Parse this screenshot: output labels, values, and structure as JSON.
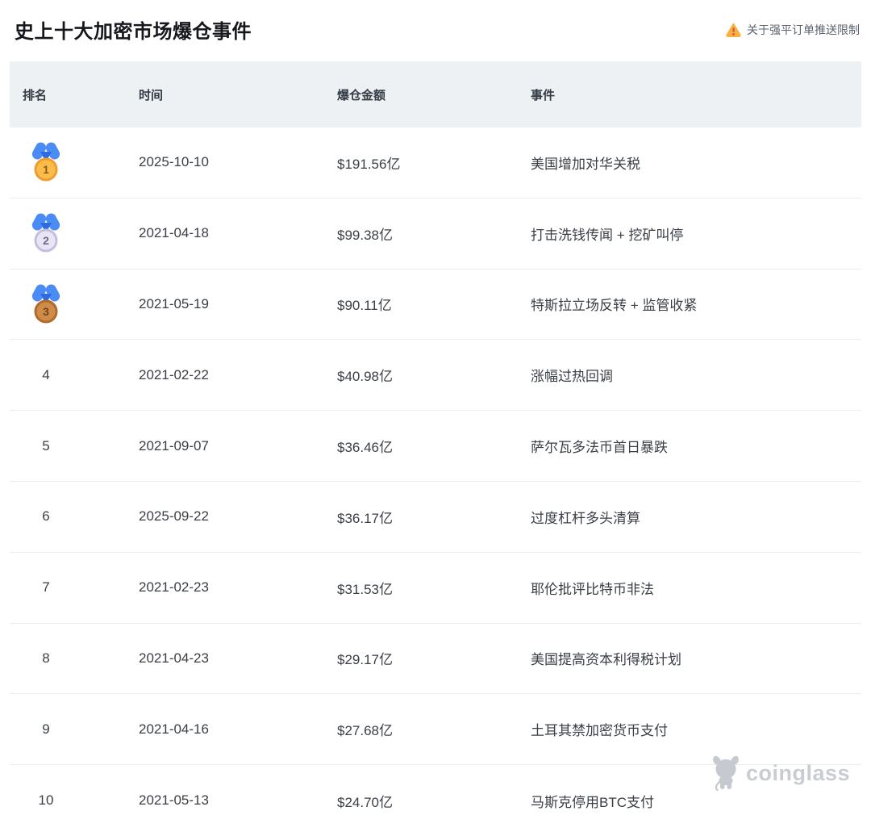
{
  "page": {
    "title": "史上十大加密市场爆仓事件",
    "notice": {
      "label": "关于强平订单推送限制",
      "icon": "warning-triangle-icon",
      "icon_color": "#f9b041"
    }
  },
  "table": {
    "columns": {
      "rank": "排名",
      "time": "时间",
      "amount": "爆仓金额",
      "event": "事件"
    },
    "rows": [
      {
        "rank": "1",
        "medal": "gold",
        "date": "2025-10-10",
        "amount": "$191.56亿",
        "event": "美国增加对华关税"
      },
      {
        "rank": "2",
        "medal": "silver",
        "date": "2021-04-18",
        "amount": "$99.38亿",
        "event": "打击洗钱传闻 + 挖矿叫停"
      },
      {
        "rank": "3",
        "medal": "bronze",
        "date": "2021-05-19",
        "amount": "$90.11亿",
        "event": "特斯拉立场反转 + 监管收紧"
      },
      {
        "rank": "4",
        "medal": null,
        "date": "2021-02-22",
        "amount": "$40.98亿",
        "event": "涨幅过热回调"
      },
      {
        "rank": "5",
        "medal": null,
        "date": "2021-09-07",
        "amount": "$36.46亿",
        "event": "萨尔瓦多法币首日暴跌"
      },
      {
        "rank": "6",
        "medal": null,
        "date": "2025-09-22",
        "amount": "$36.17亿",
        "event": "过度杠杆多头清算"
      },
      {
        "rank": "7",
        "medal": null,
        "date": "2021-02-23",
        "amount": "$31.53亿",
        "event": "耶伦批评比特币非法"
      },
      {
        "rank": "8",
        "medal": null,
        "date": "2021-04-23",
        "amount": "$29.17亿",
        "event": "美国提高资本利得税计划"
      },
      {
        "rank": "9",
        "medal": null,
        "date": "2021-04-16",
        "amount": "$27.68亿",
        "event": "土耳其禁加密货币支付"
      },
      {
        "rank": "10",
        "medal": null,
        "date": "2021-05-13",
        "amount": "$24.70亿",
        "event": "马斯克停用BTC支付"
      }
    ]
  },
  "watermark": {
    "brand": "coinglass",
    "icon": "coinglass-bull-icon"
  },
  "colors": {
    "header_background": "#eef1f4",
    "row_divider": "#ebedf0",
    "title_text": "#15171c",
    "cell_text": "#3a3f46",
    "notice_text": "#5a626e",
    "warning_amber": "#f9b041",
    "warning_exclamation": "#dd5a43",
    "ribbon_blue": "#4a8bf5",
    "medal_gold": "#fbbc49",
    "medal_silver": "#e9e5f4",
    "medal_bronze": "#cf8c49",
    "watermark_gray": "#c9cdd3"
  }
}
